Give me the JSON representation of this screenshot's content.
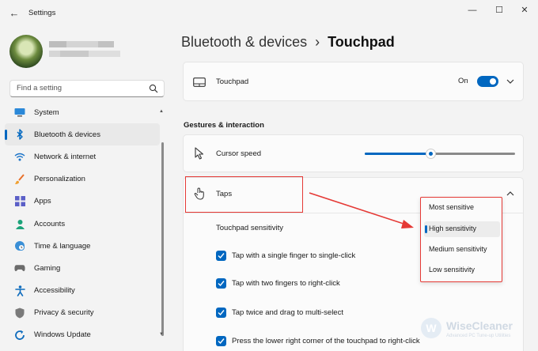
{
  "window": {
    "title": "Settings",
    "back_glyph": "←",
    "minimize_glyph": "—",
    "maximize_glyph": "☐",
    "close_glyph": "✕"
  },
  "search": {
    "placeholder": "Find a setting"
  },
  "sidebar": {
    "items": [
      {
        "label": "System",
        "icon": "monitor-icon"
      },
      {
        "label": "Bluetooth & devices",
        "icon": "bluetooth-icon",
        "active": true
      },
      {
        "label": "Network & internet",
        "icon": "wifi-icon"
      },
      {
        "label": "Personalization",
        "icon": "brush-icon"
      },
      {
        "label": "Apps",
        "icon": "apps-icon"
      },
      {
        "label": "Accounts",
        "icon": "person-icon"
      },
      {
        "label": "Time & language",
        "icon": "globe-clock-icon"
      },
      {
        "label": "Gaming",
        "icon": "gamepad-icon"
      },
      {
        "label": "Accessibility",
        "icon": "accessibility-icon"
      },
      {
        "label": "Privacy & security",
        "icon": "shield-icon"
      },
      {
        "label": "Windows Update",
        "icon": "update-icon"
      }
    ]
  },
  "breadcrumb": {
    "parent": "Bluetooth & devices",
    "separator": "›",
    "current": "Touchpad"
  },
  "touchpad": {
    "label": "Touchpad",
    "state_label": "On",
    "enabled": true
  },
  "gestures": {
    "section_title": "Gestures & interaction",
    "cursor_speed_label": "Cursor speed",
    "cursor_speed_value": 0.44
  },
  "taps": {
    "label": "Taps",
    "sensitivity_label": "Touchpad sensitivity",
    "options": [
      {
        "label": "Tap with a single finger to single-click",
        "checked": true
      },
      {
        "label": "Tap with two fingers to right-click",
        "checked": true
      },
      {
        "label": "Tap twice and drag to multi-select",
        "checked": true
      },
      {
        "label": "Press the lower right corner of the touchpad to right-click",
        "checked": true
      }
    ]
  },
  "sensitivity_dropdown": {
    "options": [
      "Most sensitive",
      "High sensitivity",
      "Medium sensitivity",
      "Low sensitivity"
    ],
    "selected": "High sensitivity"
  },
  "colors": {
    "accent": "#0067c0",
    "highlight": "#e53935"
  },
  "watermark": {
    "name": "WiseCleaner",
    "tagline": "Advanced PC Tune-up Utilities"
  }
}
